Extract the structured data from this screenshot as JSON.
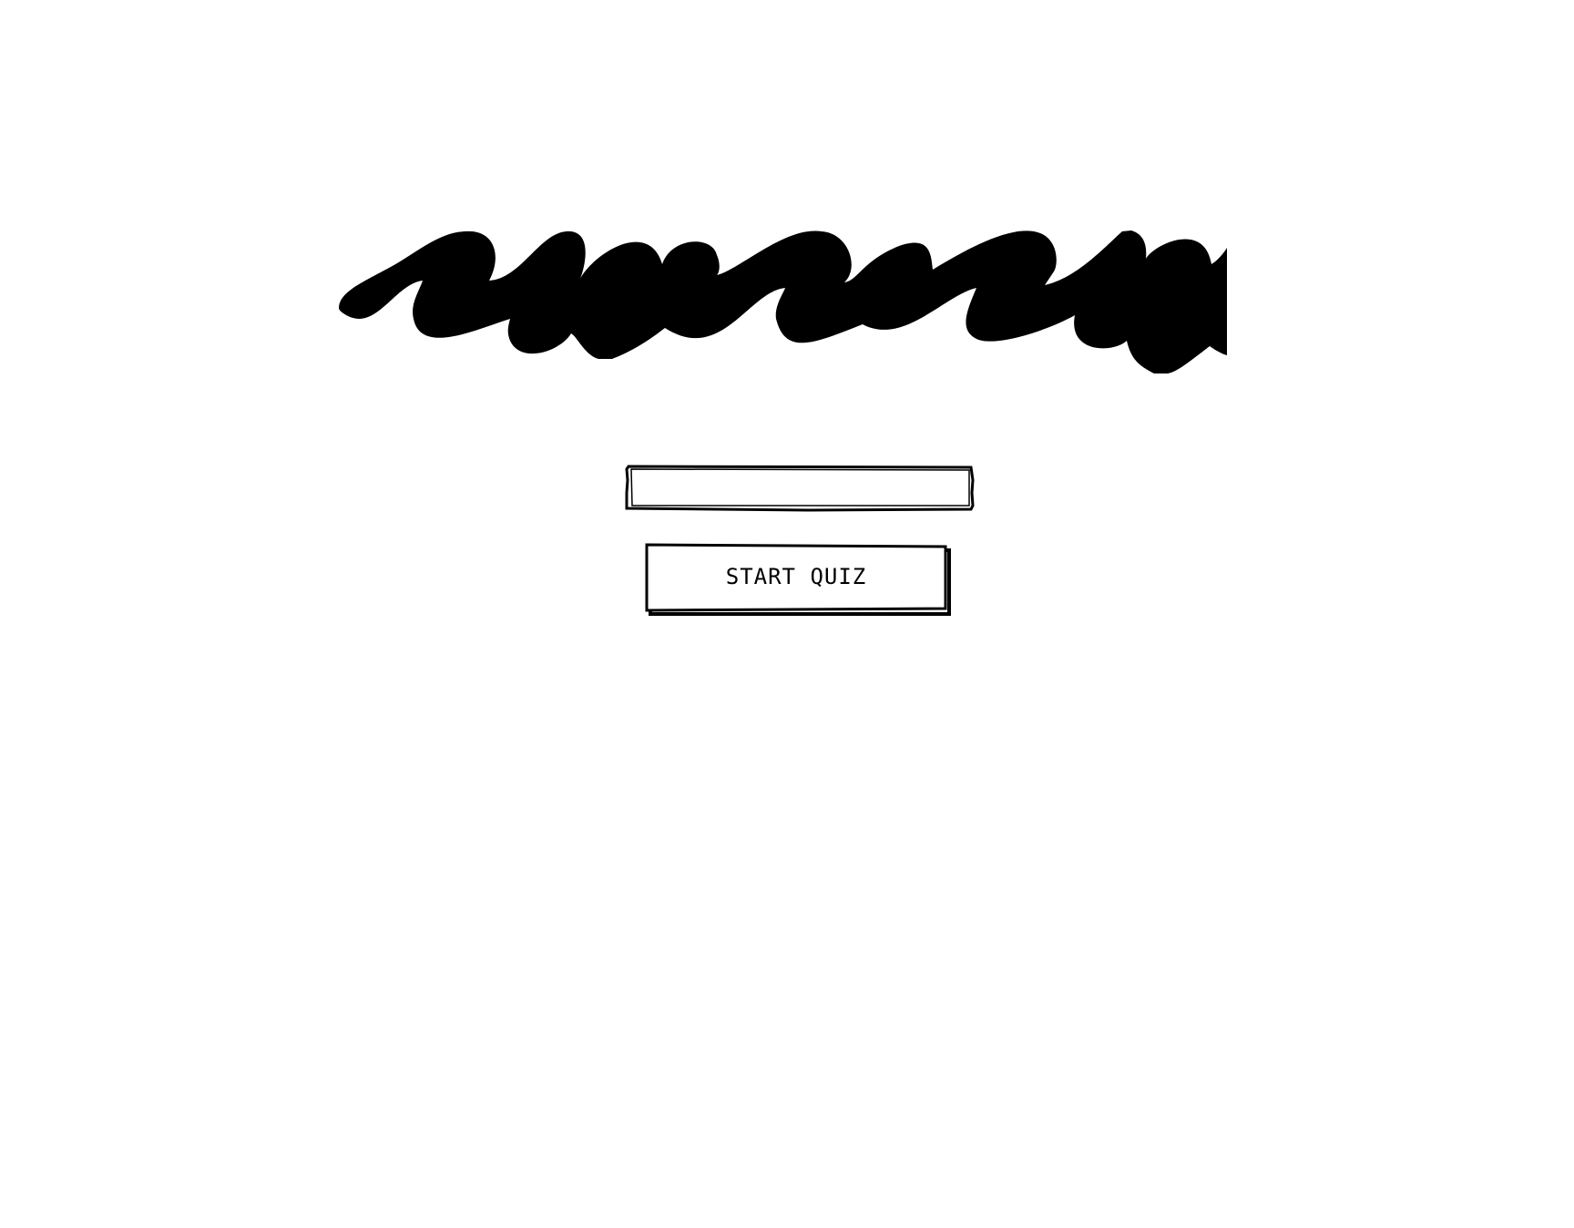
{
  "app": {
    "title_image": "scribbled-heading-graphic"
  },
  "name_field": {
    "value": "",
    "placeholder": ""
  },
  "start_button": {
    "label": "START QUIZ"
  },
  "colors": {
    "ink": "#000000",
    "background": "#ffffff"
  }
}
